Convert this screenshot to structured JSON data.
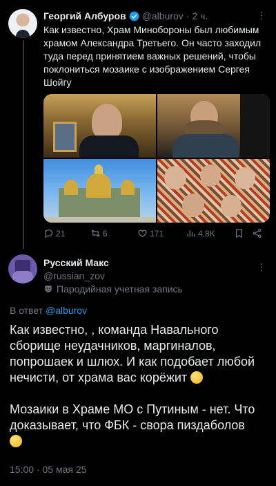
{
  "tweet1": {
    "author_name": "Георгий Албуров",
    "handle": "@alburov",
    "separator": "·",
    "time": "2 ч.",
    "more": "⋮",
    "text": "Как известно, Храм Минобороны был любимым храмом Александра Третьего. Он часто заходил туда перед принятием важных решений, чтобы поклониться мозаике с изображением Сергея Шойгу",
    "stats": {
      "replies": "21",
      "retweets": "6",
      "likes": "171",
      "views": "4,8K"
    }
  },
  "tweet2": {
    "author_name": "Русский Макс",
    "handle": "@russian_zov",
    "more": "⋮",
    "parody_label": "Пародийная учетная запись",
    "replying_prefix": "В ответ",
    "replying_to": "@alburov",
    "paragraph1": "Как известно, , команда Навального сборище неудачников, маргиналов, попрошаек и шлюх. И как подобает любой нечисти, от храма вас корёжит",
    "paragraph2": "Мозаики в Храме МО с Путиным - нет. Что доказывает, что ФБК - свора пиздаболов",
    "timestamp": "15:00 · 05 мая 25"
  },
  "icons": {
    "verified": "verified-badge-icon",
    "reply": "reply-icon",
    "retweet": "retweet-icon",
    "like": "heart-icon",
    "views": "views-chart-icon",
    "bookmark": "bookmark-icon",
    "share": "share-icon",
    "parody": "parody-mask-icon"
  },
  "colors": {
    "background": "#000000",
    "text": "#e7e9ea",
    "muted": "#71767b",
    "link": "#1d9bf0",
    "verified": "#1d9bf0"
  }
}
